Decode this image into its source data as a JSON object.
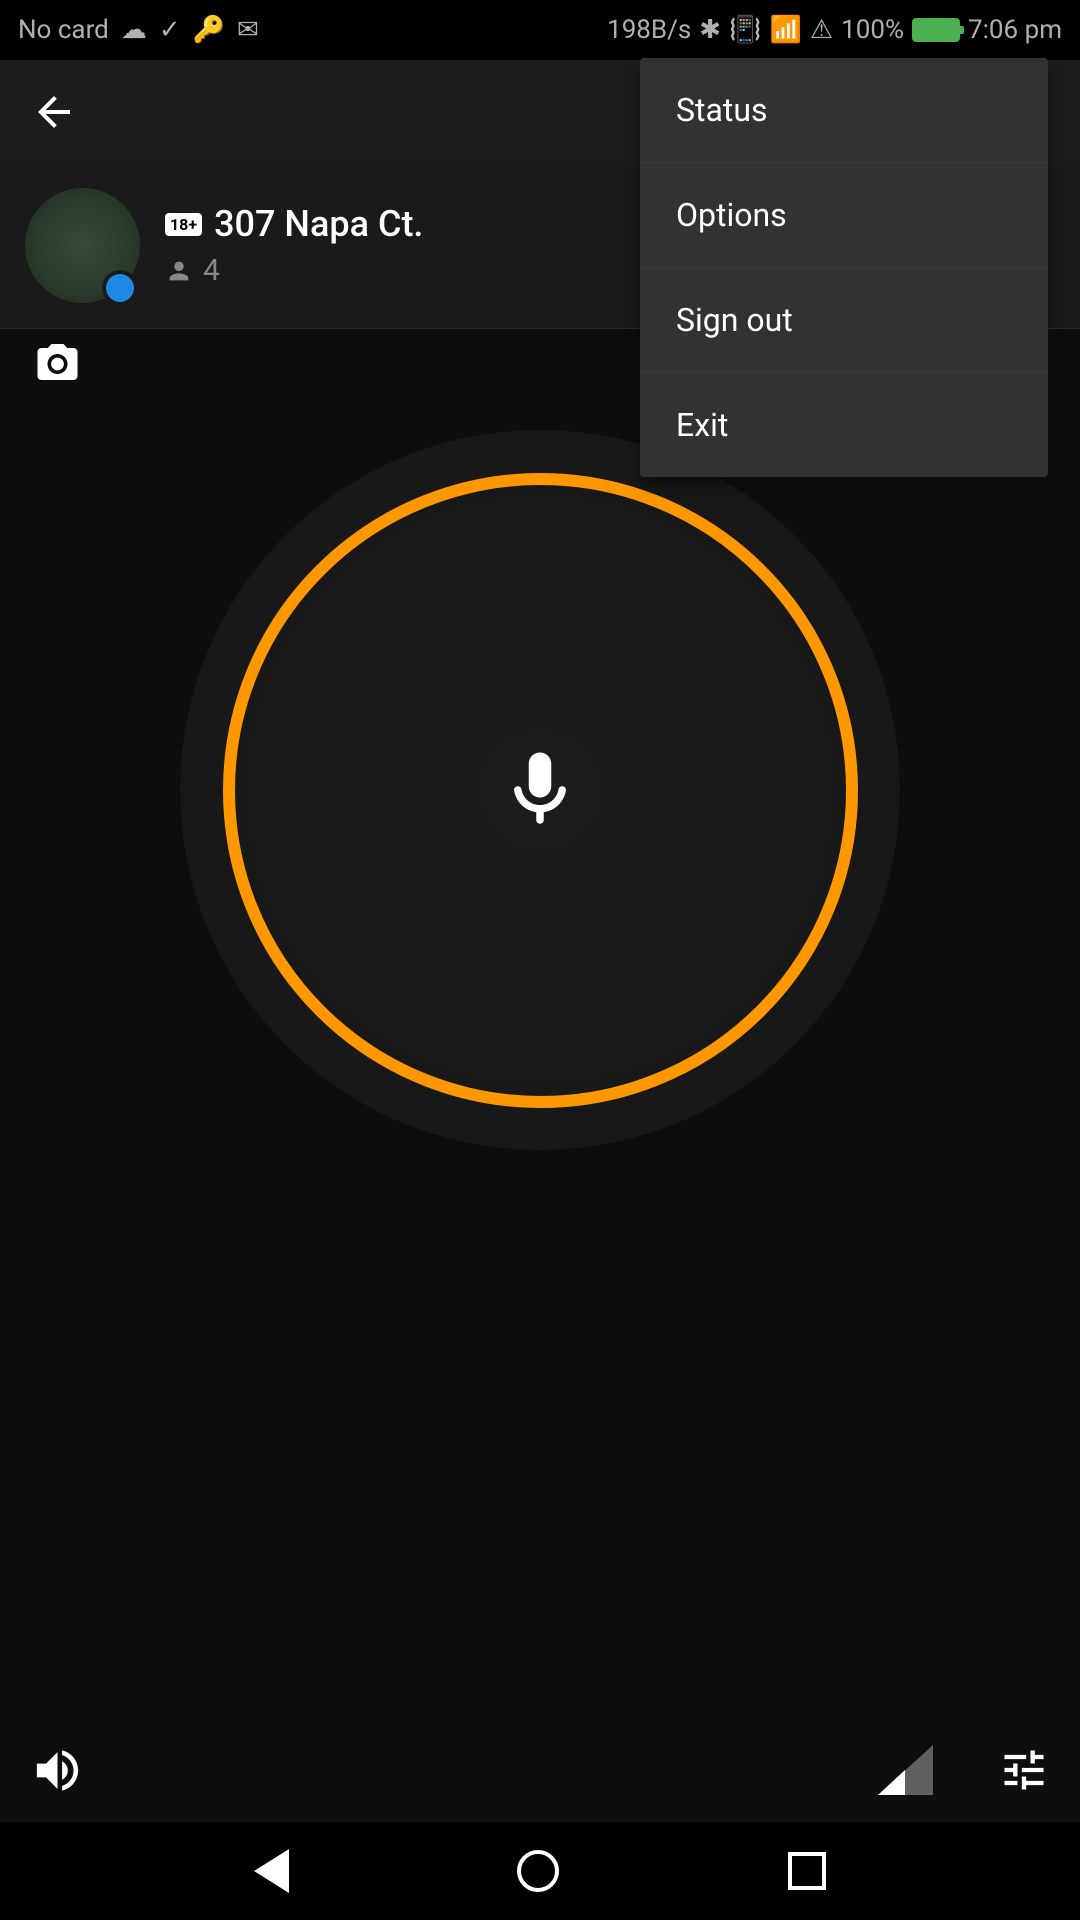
{
  "statusBar": {
    "noCard": "No card",
    "dataRate": "198B/s",
    "battery": "100%",
    "time": "7:06 pm"
  },
  "channel": {
    "name": "307 Napa Ct.",
    "ageBadge": "18+",
    "memberCount": "4"
  },
  "menu": {
    "status": "Status",
    "options": "Options",
    "signOut": "Sign out",
    "exit": "Exit"
  }
}
